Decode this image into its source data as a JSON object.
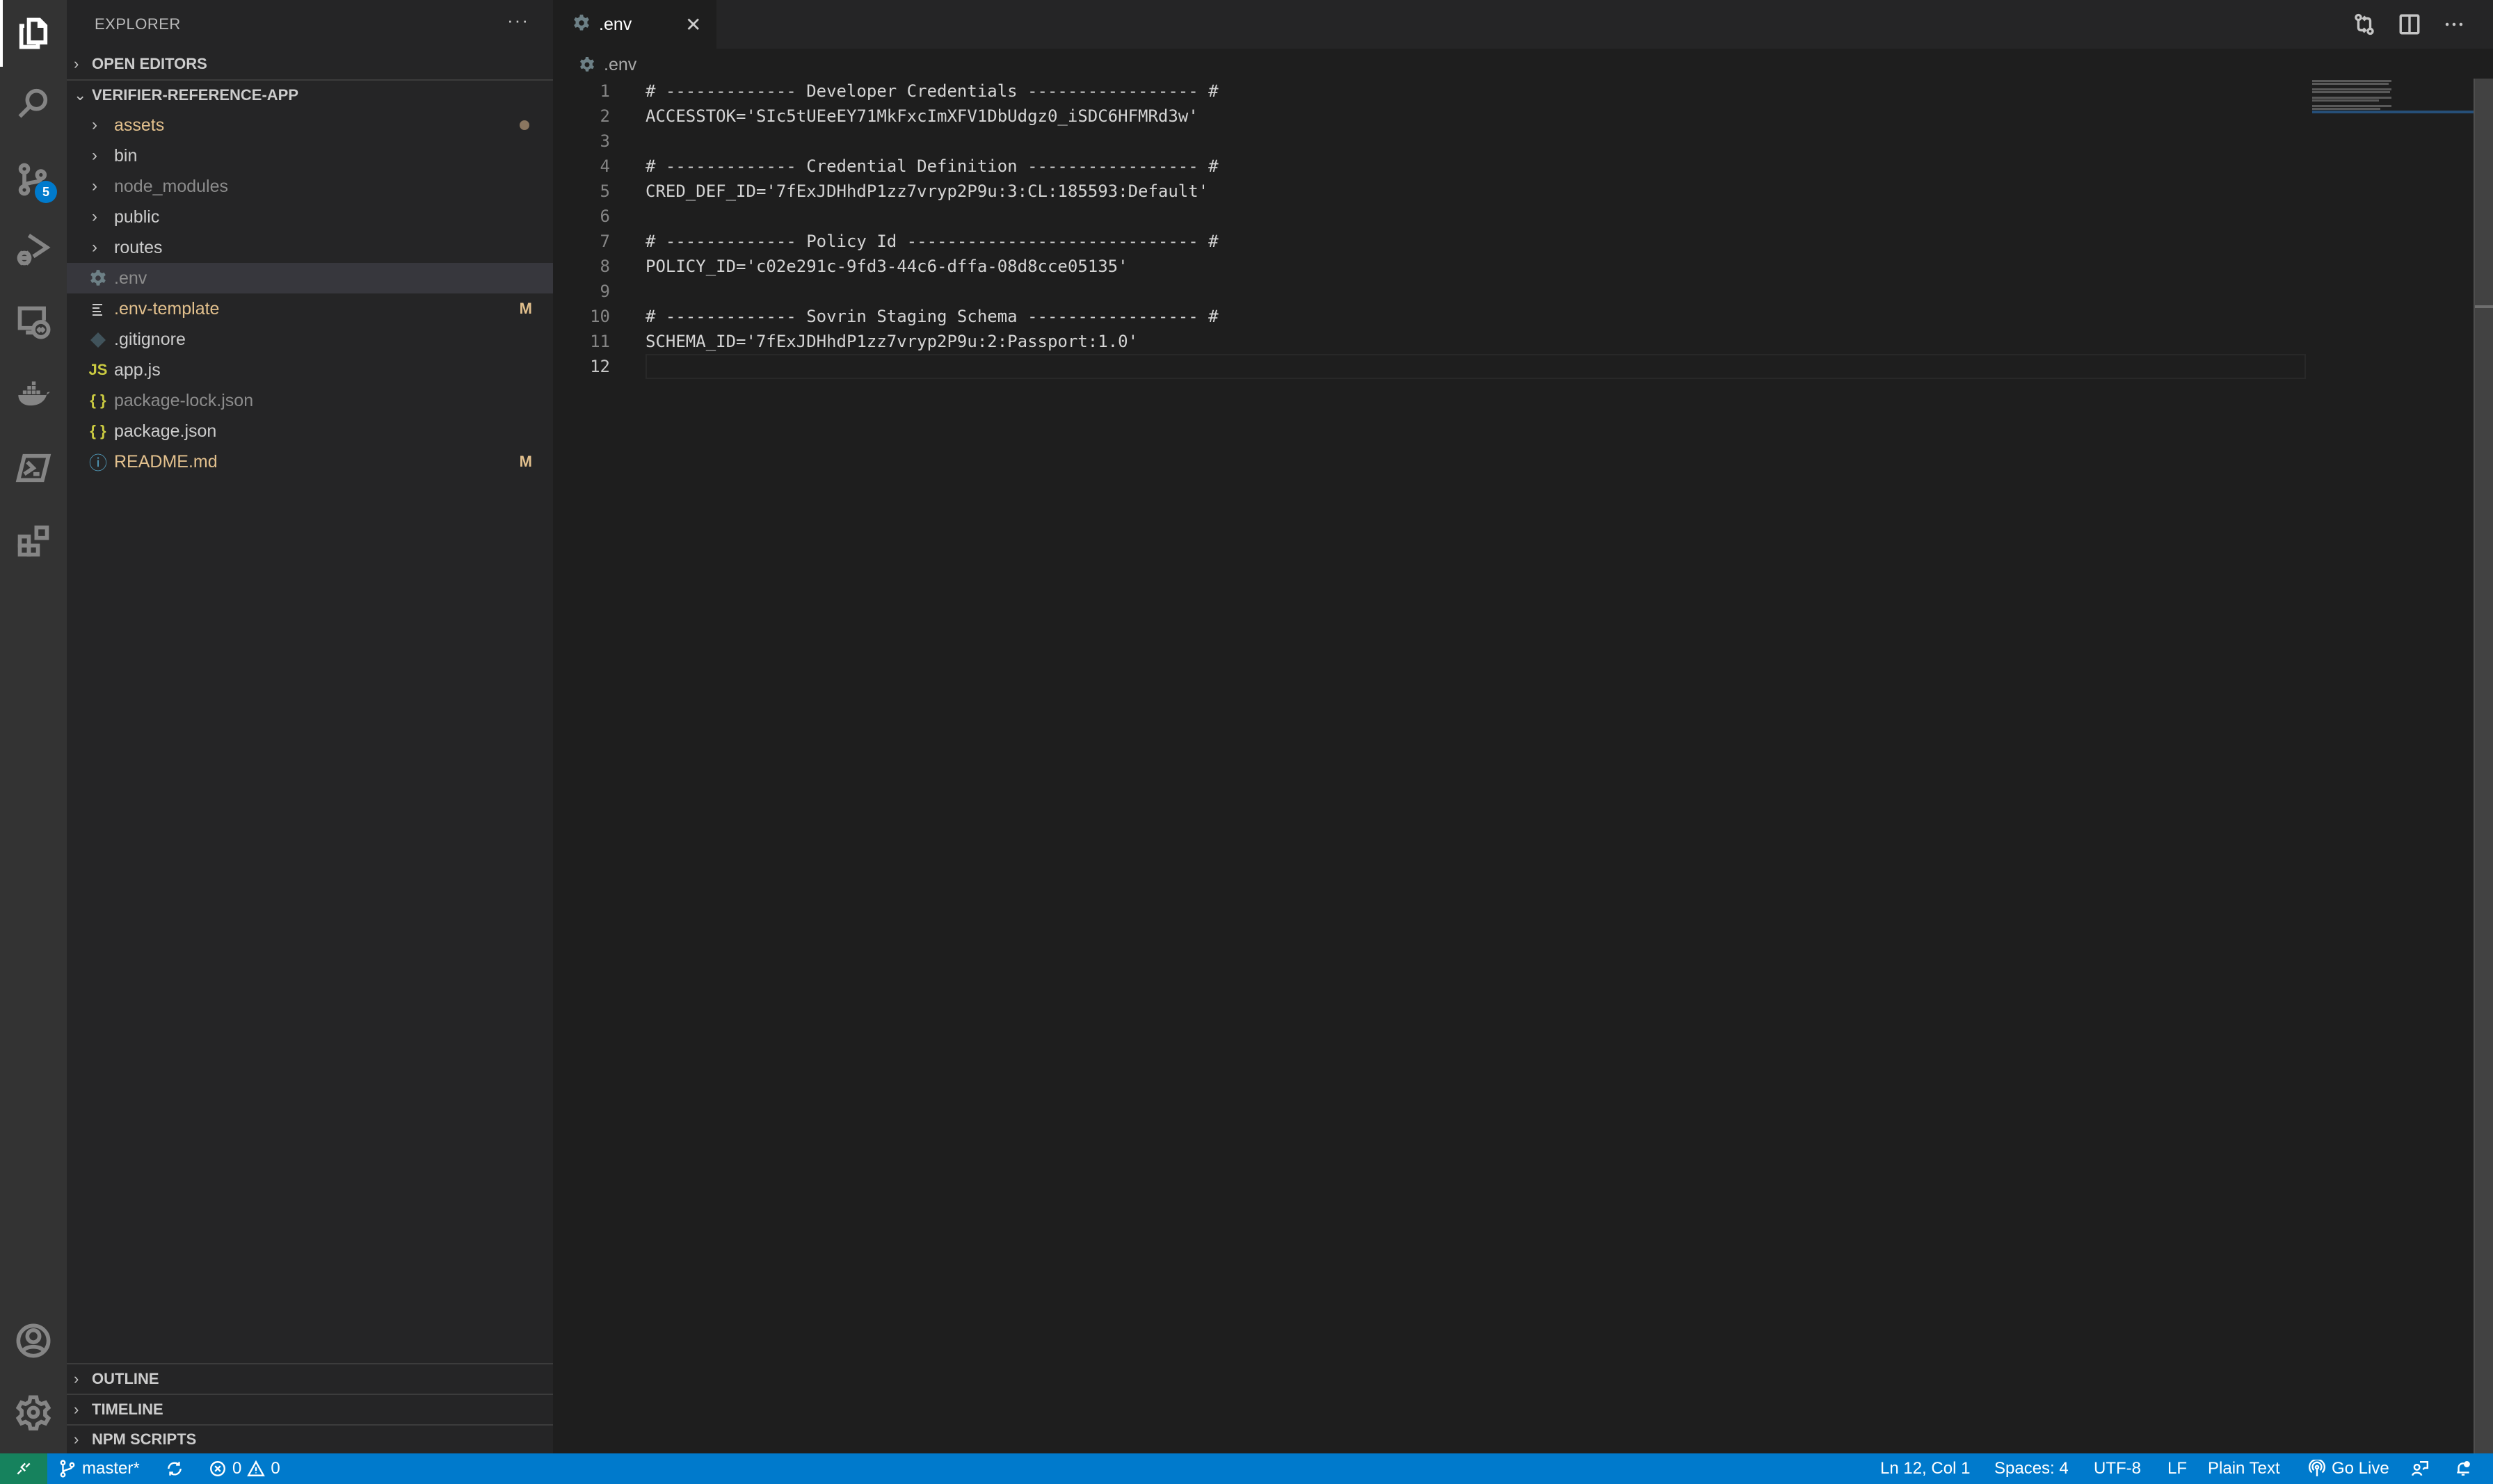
{
  "activity_bar": {
    "items": [
      {
        "id": "explorer",
        "icon": "files-icon",
        "active": true
      },
      {
        "id": "search",
        "icon": "search-icon"
      },
      {
        "id": "source-control",
        "icon": "source-control-icon",
        "badge": "5"
      },
      {
        "id": "run-debug",
        "icon": "run-debug-icon"
      },
      {
        "id": "remote-explorer",
        "icon": "remote-explorer-icon"
      },
      {
        "id": "docker",
        "icon": "docker-icon"
      },
      {
        "id": "powershell",
        "icon": "terminal-icon"
      },
      {
        "id": "extensions",
        "icon": "extensions-icon"
      }
    ],
    "bottom": [
      {
        "id": "accounts",
        "icon": "account-icon"
      },
      {
        "id": "manage",
        "icon": "gear-icon"
      }
    ]
  },
  "sidebar": {
    "title": "EXPLORER",
    "more_label": "···",
    "open_editors": "OPEN EDITORS",
    "folder": "VERIFIER-REFERENCE-APP",
    "tree": [
      {
        "name": "assets",
        "type": "folder",
        "status": "modified",
        "decoration": "dot"
      },
      {
        "name": "bin",
        "type": "folder"
      },
      {
        "name": "node_modules",
        "type": "folder",
        "status": "ignored"
      },
      {
        "name": "public",
        "type": "folder"
      },
      {
        "name": "routes",
        "type": "folder"
      },
      {
        "name": ".env",
        "type": "file",
        "icon": "gear-icon",
        "status": "ignored",
        "selected": true
      },
      {
        "name": ".env-template",
        "type": "file",
        "icon": "text-lines-icon",
        "status": "modified",
        "decoration": "M"
      },
      {
        "name": ".gitignore",
        "type": "file",
        "icon": "git-icon"
      },
      {
        "name": "app.js",
        "type": "file",
        "icon": "js-icon",
        "icon_text": "JS"
      },
      {
        "name": "package-lock.json",
        "type": "file",
        "icon": "json-icon",
        "icon_text": "{ }",
        "status": "ignored"
      },
      {
        "name": "package.json",
        "type": "file",
        "icon": "json-icon",
        "icon_text": "{ }"
      },
      {
        "name": "README.md",
        "type": "file",
        "icon": "info-icon",
        "icon_text": "ⓘ",
        "status": "modified",
        "decoration": "M"
      }
    ],
    "bottom_sections": [
      "OUTLINE",
      "TIMELINE",
      "NPM SCRIPTS"
    ]
  },
  "editor": {
    "tabs": [
      {
        "label": ".env",
        "active": true,
        "close": "✕"
      }
    ],
    "breadcrumb": ".env",
    "current_line": 12,
    "lines": [
      "# ------------- Developer Credentials ----------------- #",
      "ACCESSTOK='SIc5tUEeEY71MkFxcImXFV1DbUdgz0_iSDC6HFMRd3w'",
      "",
      "# ------------- Credential Definition ----------------- #",
      "CRED_DEF_ID='7fExJDHhdP1zz7vryp2P9u:3:CL:185593:Default'",
      "",
      "# ------------- Policy Id ----------------------------- #",
      "POLICY_ID='c02e291c-9fd3-44c6-dffa-08d8cce05135'",
      "",
      "# ------------- Sovrin Staging Schema ----------------- #",
      "SCHEMA_ID='7fExJDHhdP1zz7vryp2P9u:2:Passport:1.0'",
      ""
    ],
    "toolbar": [
      "open-changes-icon",
      "split-editor-icon",
      "more-actions-icon"
    ]
  },
  "status_bar": {
    "remote_icon": "remote-icon",
    "branch": "master*",
    "errors": "0",
    "warnings": "0",
    "cursor": "Ln 12, Col 1",
    "indent": "Spaces: 4",
    "encoding": "UTF-8",
    "eol": "LF",
    "language": "Plain Text",
    "go_live": "Go Live",
    "colors": {
      "background": "#007acc",
      "remote": "#16825d"
    }
  }
}
